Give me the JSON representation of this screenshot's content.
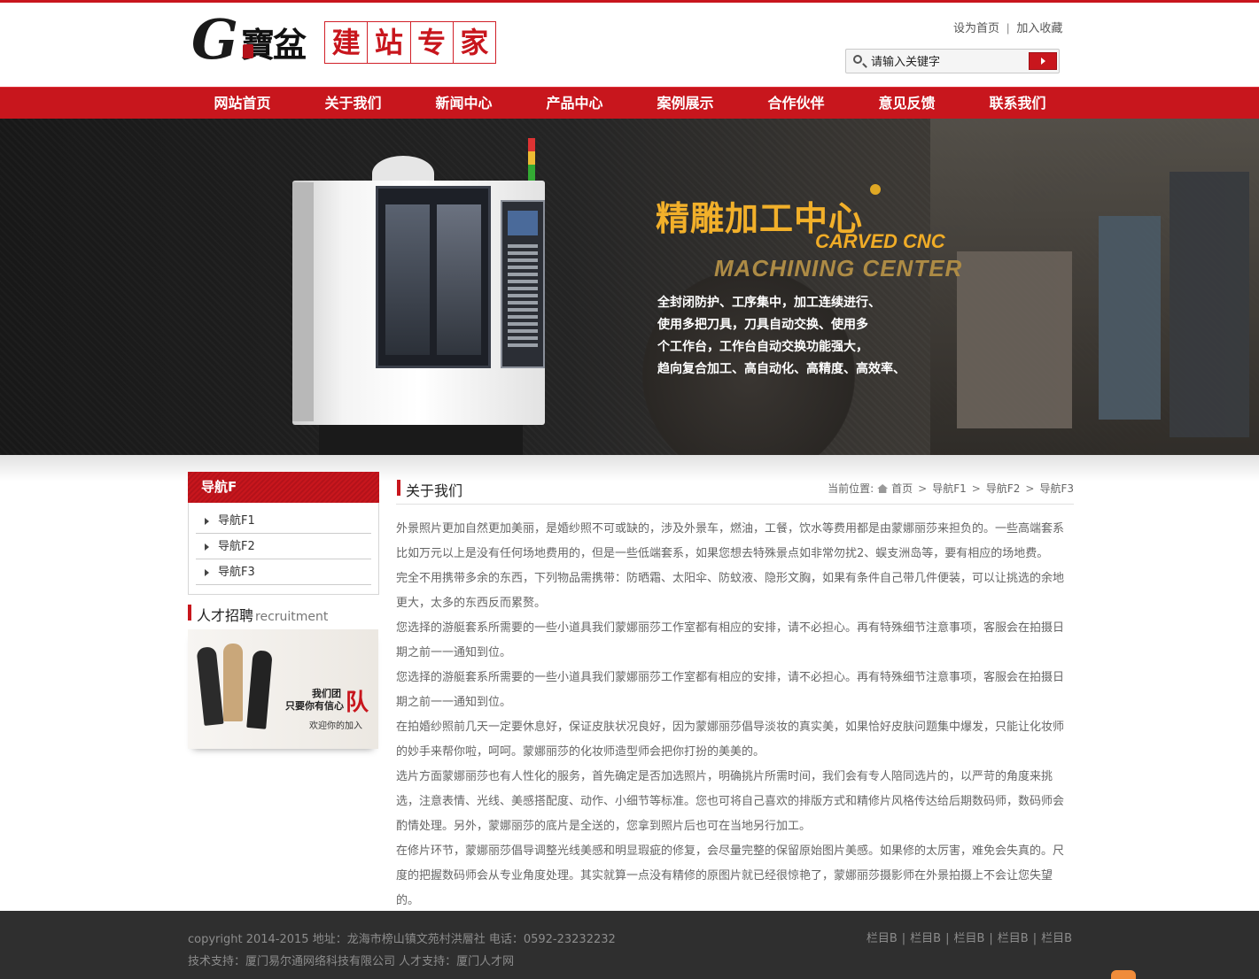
{
  "header": {
    "logo": {
      "glyph": "G",
      "hanzi": "寶盆",
      "slogan": [
        "建",
        "站",
        "专",
        "家"
      ]
    },
    "toplinks": {
      "home": "设为首页",
      "separator": "|",
      "favorite": "加入收藏"
    },
    "search": {
      "placeholder": "请输入关键字"
    }
  },
  "nav": [
    "网站首页",
    "关于我们",
    "新闻中心",
    "产品中心",
    "案例展示",
    "合作伙伴",
    "意见反馈",
    "联系我们"
  ],
  "banner": {
    "title": "精雕加工中心",
    "en1": "CARVED CNC",
    "en2": "MACHINING CENTER",
    "lines": [
      "全封闭防护、工序集中，加工连续进行、",
      "使用多把刀具，刀具自动交换、使用多",
      "个工作台，工作台自动交换功能强大，",
      "趋向复合加工、高自动化、高精度、高效率、"
    ]
  },
  "sidebar": {
    "heading": "导航F",
    "items": [
      "导航F1",
      "导航F2",
      "导航F3"
    ],
    "recruit_title": "人才招聘",
    "recruit_en": "recruitment",
    "recruit_image": {
      "line1": "我们团",
      "line2": "只要你有信心",
      "big": "队",
      "line3": "欢迎你的加入"
    }
  },
  "main": {
    "title": "关于我们",
    "breadcrumb": {
      "label": "当前位置:",
      "items": [
        "首页",
        "导航F1",
        "导航F2",
        "导航F3"
      ],
      "separator": ">"
    },
    "paragraphs": [
      "外景照片更加自然更加美丽，是婚纱照不可或缺的，涉及外景车，燃油，工餐，饮水等费用都是由蒙娜丽莎来担负的。一些高端套系比如万元以上是没有任何场地费用的，但是一些低端套系，如果您想去特殊景点如非常勿扰2、蜈支洲岛等，要有相应的场地费。",
      "完全不用携带多余的东西，下列物品需携带：防晒霜、太阳伞、防蚊液、隐形文胸，如果有条件自己带几件便装，可以让挑选的余地更大，太多的东西反而累赘。",
      "您选择的游艇套系所需要的一些小道具我们蒙娜丽莎工作室都有相应的安排，请不必担心。再有特殊细节注意事项，客服会在拍摄日期之前一一通知到位。",
      "您选择的游艇套系所需要的一些小道具我们蒙娜丽莎工作室都有相应的安排，请不必担心。再有特殊细节注意事项，客服会在拍摄日期之前一一通知到位。",
      "在拍婚纱照前几天一定要休息好，保证皮肤状况良好，因为蒙娜丽莎倡导淡妆的真实美，如果恰好皮肤问题集中爆发，只能让化妆师的妙手来帮你啦，呵呵。蒙娜丽莎的化妆师造型师会把你打扮的美美的。",
      "选片方面蒙娜丽莎也有人性化的服务，首先确定是否加选照片，明确挑片所需时间，我们会有专人陪同选片的，以严苛的角度来挑选，注意表情、光线、美感搭配度、动作、小细节等标准。您也可将自己喜欢的排版方式和精修片风格传达给后期数码师，数码师会酌情处理。另外，蒙娜丽莎的底片是全送的，您拿到照片后也可在当地另行加工。",
      "在修片环节，蒙娜丽莎倡导调整光线美感和明显瑕疵的修复，会尽量完整的保留原始图片美感。如果修的太厉害，难免会失真的。尺度的把握数码师会从专业角度处理。其实就算一点没有精修的原图片就已经很惊艳了，蒙娜丽莎摄影师在外景拍摄上不会让您失望的。"
    ]
  },
  "footer": {
    "line1": "copyright 2014-2015 地址：龙海市榜山镇文苑村洪層社 电话：0592-23232232",
    "line2": "技术支持：厦门易尔通网络科技有限公司 人才支持：厦门人才网",
    "links": [
      "栏目B",
      "栏目B",
      "栏目B",
      "栏目B",
      "栏目B"
    ],
    "link_separator": "|"
  },
  "colors": {
    "brand_red": "#c8161d",
    "footer_bg": "#2f2f2f",
    "banner_gold": "#f2b02a"
  }
}
